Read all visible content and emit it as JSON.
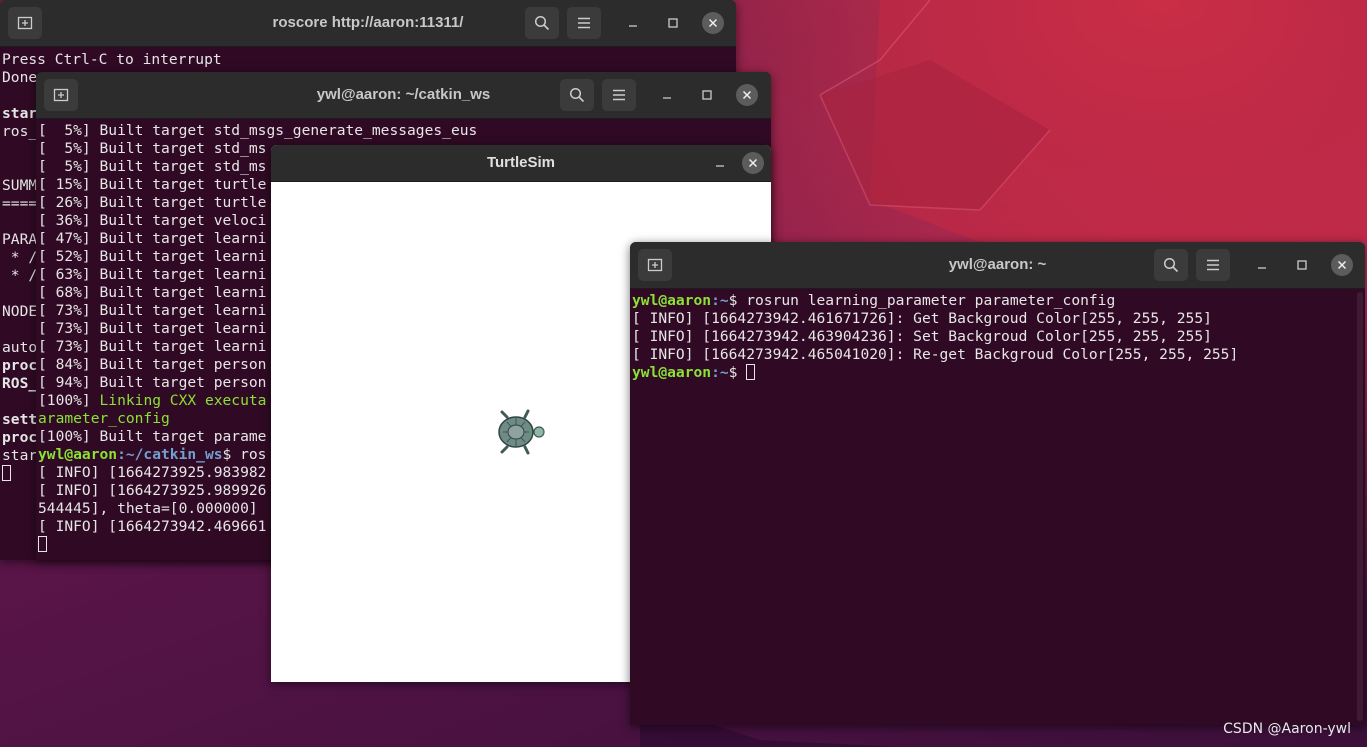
{
  "roscore_window": {
    "title": "roscore http://aaron:11311/",
    "lines": [
      "Press Ctrl-C to interrupt",
      "Done"
    ],
    "edge": [
      "star",
      "ros_",
      "",
      "",
      "SUMM",
      "====",
      "",
      "PARA",
      " * /",
      " * /",
      "",
      "NODE",
      "",
      "auto",
      "proc",
      "ROS_",
      "",
      "sett",
      "proc",
      "star"
    ]
  },
  "catkin_window": {
    "title": "ywl@aaron: ~/catkin_ws",
    "lines": [
      "[  5%] Built target std_msgs_generate_messages_eus",
      "[  5%] Built target std_ms",
      "[  5%] Built target std_ms",
      "[ 15%] Built target turtle",
      "[ 26%] Built target turtle",
      "[ 36%] Built target veloci",
      "[ 47%] Built target learni",
      "[ 52%] Built target learni",
      "[ 63%] Built target learni",
      "[ 68%] Built target learni",
      "[ 73%] Built target learni",
      "[ 73%] Built target learni",
      "[ 73%] Built target learni",
      "[ 84%] Built target person",
      "[ 94%] Built target person",
      "[100%] ",
      "arameter_config",
      "[100%] Built target parame",
      "ywl@aaron",
      "[ INFO] [1664273925.983982",
      "[ INFO] [1664273925.989926",
      "544445], theta=[0.000000]",
      "[ INFO] [1664273942.469661"
    ],
    "linking_text": "Linking CXX executa",
    "prompt_path": ":~/catkin_ws",
    "prompt_rest": "$ ros"
  },
  "turtlesim_window": {
    "title": "TurtleSim",
    "background": "#ffffff"
  },
  "home_window": {
    "title": "ywl@aaron: ~",
    "prompt_user": "ywl@aaron",
    "prompt_path": ":~",
    "prompt_symbol": "$ ",
    "command": "rosrun learning_parameter parameter_config",
    "lines": [
      "[ INFO] [1664273942.461671726]: Get Backgroud Color[255, 255, 255]",
      "[ INFO] [1664273942.463904236]: Set Backgroud Color[255, 255, 255]",
      "[ INFO] [1664273942.465041020]: Re-get Backgroud Color[255, 255, 255]"
    ]
  },
  "watermark": "CSDN @Aaron-ywl",
  "icons": {
    "new_tab": "new-tab-icon",
    "search": "search-icon",
    "menu": "hamburger-menu-icon",
    "minimize": "minimize-icon",
    "maximize": "maximize-icon",
    "close": "close-icon"
  }
}
